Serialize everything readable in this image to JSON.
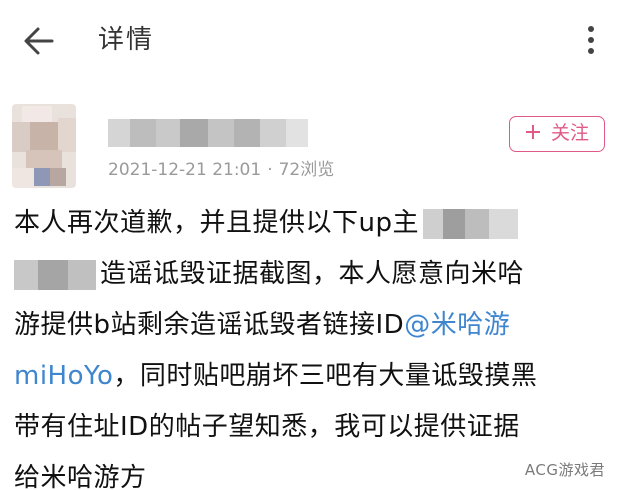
{
  "header": {
    "title": "详情",
    "back_icon": "arrow-left-icon",
    "more_icon": "more-vertical-icon"
  },
  "post": {
    "timestamp": "2021-12-21 21:01",
    "separator": "·",
    "views": "72浏览",
    "follow_label": "关注",
    "follow_icon": "plus-icon",
    "accent_color": "#e05a86",
    "mention_color": "#3f86cf",
    "lines": {
      "l1": "本人再次道歉，并且提供以下up主",
      "l2": "造谣诋毁证据截图，本人愿意向米哈",
      "l3": "游提供b站剩余造谣诋毁者链接ID",
      "l3_mention": "@米哈游",
      "l4_mention": "miHoYo",
      "l4": "，同时贴吧崩坏三吧有大量诋毁摸黑",
      "l5": "带有住址ID的帖子望知悉，我可以提供证据",
      "l6": "给米哈游方"
    }
  },
  "watermark": "ACG游戏君"
}
